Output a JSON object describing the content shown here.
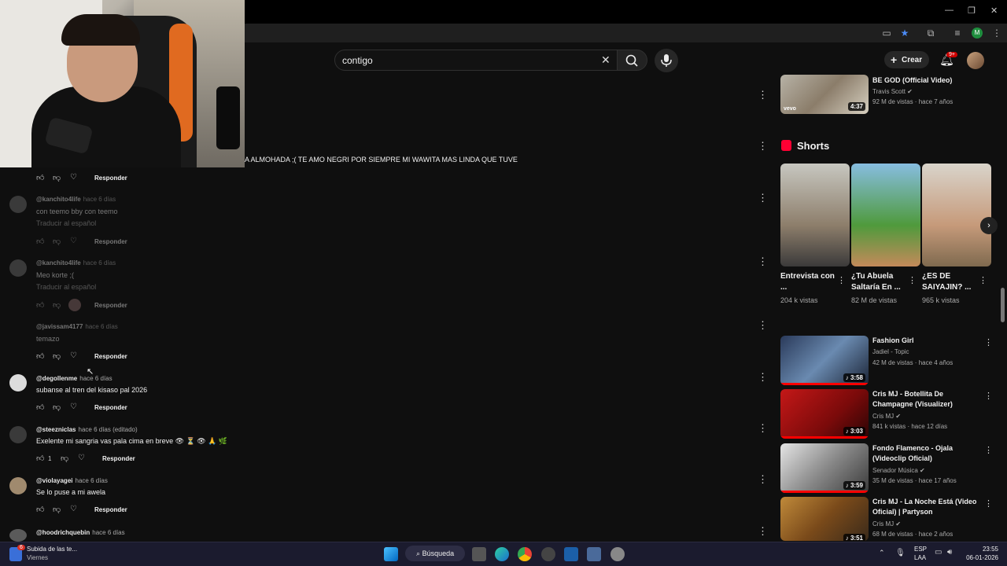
{
  "browser": {
    "window_controls": [
      "—",
      "❐",
      "✕"
    ]
  },
  "header": {
    "search_value": "contigo",
    "create_label": "Crear",
    "notif_badge": "9+",
    "profile_initial": "M"
  },
  "overlay_comment": "A ALMOHADA ;( TE AMO NEGRI POR SIEMPRE MI WAWITA MAS LINDA QUE TUVE",
  "comments": [
    {
      "author": "",
      "time": "",
      "text": "",
      "translate": "",
      "likes": "",
      "reply": "Responder"
    },
    {
      "author": "@kanchito4life",
      "time": "hace 6 días",
      "text": "con teemo bby con teemo",
      "translate": "Traducir al español",
      "likes": "",
      "reply": "Responder"
    },
    {
      "author": "@kanchito4life",
      "time": "hace 6 días",
      "text": "Meo korte ;(",
      "translate": "Traducir al español",
      "likes": "",
      "reply": "Responder"
    },
    {
      "author": "@javissam4177",
      "time": "hace 6 días",
      "text": "temazo",
      "translate": "",
      "likes": "",
      "reply": "Responder"
    },
    {
      "author": "@degollenme",
      "time": "hace 6 días",
      "text": "subanse al tren del kisaso pal 2026",
      "translate": "",
      "likes": "",
      "reply": "Responder"
    },
    {
      "author": "@steezniclas",
      "time": "hace 6 días (editado)",
      "text": "Exelente mi  sangria vas pala cima en breve 👁 ⏳ 👁 🙏 🌿",
      "translate": "",
      "likes": "1",
      "reply": "Responder"
    },
    {
      "author": "@violayagei",
      "time": "hace 6 días",
      "text": "Se lo puse a mi awela",
      "translate": "",
      "likes": "",
      "reply": "Responder"
    },
    {
      "author": "@hoodrichquebin",
      "time": "hace 6 días",
      "text": "",
      "translate": "",
      "likes": "",
      "reply": ""
    }
  ],
  "top_rec": {
    "title": "BE GOD (Official Video)",
    "channel": "Travis Scott",
    "meta": "92 M de vistas · hace 7 años",
    "duration": "4:37",
    "brand": "vevo"
  },
  "shorts": {
    "heading": "Shorts",
    "items": [
      {
        "title": "Entrevista con ...",
        "views": "204 k vistas"
      },
      {
        "title": "¿Tu Abuela Saltaría En ...",
        "views": "82 M de vistas"
      },
      {
        "title": "¿ES DE SAIYAJIN? ...",
        "views": "965 k vistas"
      }
    ]
  },
  "recommendations": [
    {
      "title": "Fashion Girl",
      "channel": "Jadiel - Topic",
      "meta": "42 M de vistas · hace 4 años",
      "duration": "3:58",
      "verified": false
    },
    {
      "title": "Cris MJ - Botellita De Champagne (Visualizer)",
      "channel": "Cris MJ",
      "meta": "841 k vistas · hace 12 días",
      "duration": "3:03",
      "verified": true
    },
    {
      "title": "Fondo Flamenco - Ojala (Videoclip Oficial)",
      "channel": "Senador Música",
      "meta": "35 M de vistas · hace 17 años",
      "duration": "3:59",
      "verified": true
    },
    {
      "title": "Cris MJ - La Noche Está (Video Oficial) | Partyson",
      "channel": "Cris MJ",
      "meta": "68 M de vistas · hace 2 años",
      "duration": "3:51",
      "verified": true
    }
  ],
  "taskbar": {
    "notif_badge": "6",
    "widget_title": "Subida de las te...",
    "widget_sub": "Viernes",
    "search_label": "Búsqueda",
    "lang": "ESP",
    "lang_sub": "LAA",
    "time": "23:55",
    "date": "06-01-2026"
  },
  "colors": {
    "bg": "#0f0f0f",
    "accent_red": "#ff0000",
    "shorts_red": "#ff0033",
    "taskbar": "#1b1b2e"
  }
}
